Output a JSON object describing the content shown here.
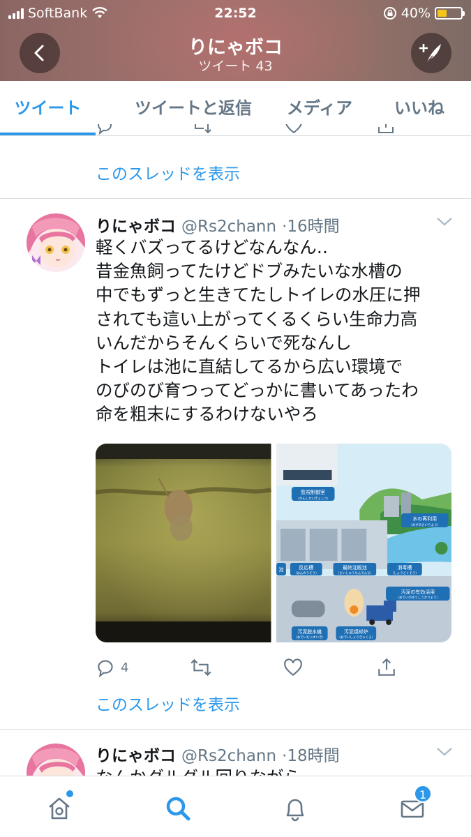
{
  "status_bar": {
    "carrier": "SoftBank",
    "time": "22:52",
    "battery": "40%",
    "battery_level": 0.4
  },
  "header": {
    "title": "りにゃボコ",
    "subtitle": "ツイート 43"
  },
  "tabs": [
    {
      "label": "ツイート",
      "active": true
    },
    {
      "label": "ツイートと返信",
      "active": false
    },
    {
      "label": "メディア",
      "active": false
    },
    {
      "label": "いいね",
      "active": false
    }
  ],
  "feed": {
    "show_thread_label": "このスレッドを表示",
    "tweets": [
      {
        "name": "りにゃボコ",
        "handle": "@Rs2chann",
        "time": "·16時間",
        "lines": [
          "軽くバズってるけどなんなん‥",
          "昔金魚飼ってたけどドブみたいな水槽の",
          "中でもずっと生きてたしトイレの水圧に押",
          "されても這い上がってくるくらい生命力高",
          "いんだからそんくらいで死なんし",
          "トイレは池に直結してるから広い環境で",
          "のびのび育つってどっかに書いてあったわ",
          "命を粗末にするわけないやろ"
        ],
        "reply_count": "4",
        "media": {
          "diagram_labels": {
            "control_room": "監視制御室",
            "control_room_kana": "（かんしせいぎょしつ）",
            "reuse": "水の再利用",
            "reuse_kana": "（みずのさいりよう）",
            "reaction_tank": "反応槽",
            "reaction_tank_kana": "（はんのうそう）",
            "final_tank": "最終沈殿池",
            "final_tank_kana": "（さいしゅうちんでんち）",
            "disinfection": "消毒槽",
            "disinfection_kana": "（しょうどくそう）",
            "sludge_use": "汚泥の有効活用",
            "sludge_use_kana": "（おでいのゆうこうかつよう）",
            "dewatering": "汚泥脱水機",
            "dewatering_kana": "（おでいだっすいき）",
            "incinerator": "汚泥焼却炉",
            "incinerator_kana": "（おでいしょうきゃくろ）",
            "left_partial": "池"
          }
        }
      },
      {
        "name": "りにゃボコ",
        "handle": "@Rs2chann",
        "time": "·18時間",
        "first_line": "なんかグルグル回りながら"
      }
    ]
  },
  "bottom_nav": {
    "messages_badge": "1"
  },
  "colors": {
    "accent": "#2c98ea",
    "secondary_text": "#657786",
    "divider": "#d9dde2"
  }
}
